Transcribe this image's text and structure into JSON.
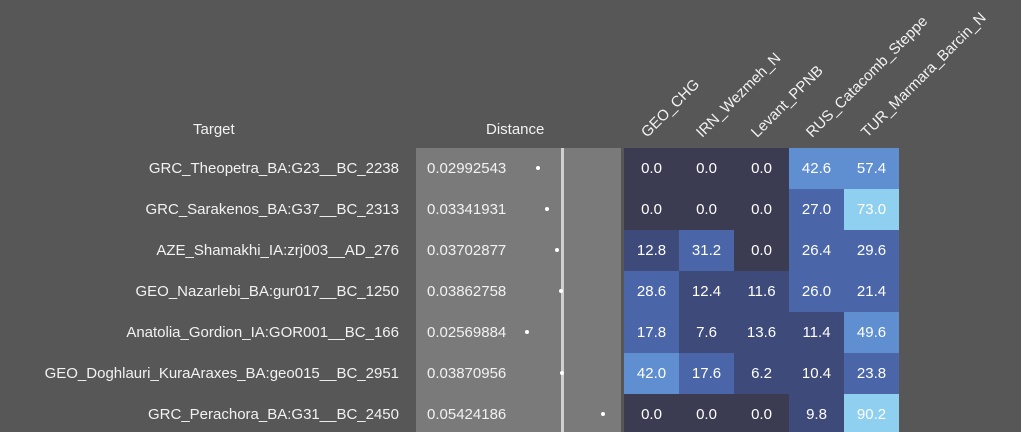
{
  "headers": {
    "target": "Target",
    "distance": "Distance"
  },
  "columns": [
    "GEO_CHG",
    "IRN_Wezmeh_N",
    "Levant_PPNB",
    "RUS_Catacomb_Steppe",
    "TUR_Marmara_Barcin_N"
  ],
  "colors": {
    "background": "#575757",
    "distance_panel": "#7a7a7a",
    "zero": "#3b3b52",
    "low": "#3d4a7a",
    "mid": "#4a66a8",
    "high": "#5f8fd0",
    "max": "#8fd0f0"
  },
  "rows": [
    {
      "target": "GRC_Theopetra_BA:G23__BC_2238",
      "distance": "0.02992543",
      "dist_num": 0.02992543,
      "values": [
        "0.0",
        "0.0",
        "0.0",
        "42.6",
        "57.4"
      ]
    },
    {
      "target": "GRC_Sarakenos_BA:G37__BC_2313",
      "distance": "0.03341931",
      "dist_num": 0.03341931,
      "values": [
        "0.0",
        "0.0",
        "0.0",
        "27.0",
        "73.0"
      ]
    },
    {
      "target": "AZE_Shamakhi_IA:zrj003__AD_276",
      "distance": "0.03702877",
      "dist_num": 0.03702877,
      "values": [
        "12.8",
        "31.2",
        "0.0",
        "26.4",
        "29.6"
      ]
    },
    {
      "target": "GEO_Nazarlebi_BA:gur017__BC_1250",
      "distance": "0.03862758",
      "dist_num": 0.03862758,
      "values": [
        "28.6",
        "12.4",
        "11.6",
        "26.0",
        "21.4"
      ]
    },
    {
      "target": "Anatolia_Gordion_IA:GOR001__BC_166",
      "distance": "0.02569884",
      "dist_num": 0.02569884,
      "values": [
        "17.8",
        "7.6",
        "13.6",
        "11.4",
        "49.6"
      ]
    },
    {
      "target": "GEO_Doghlauri_KuraAraxes_BA:geo015__BC_2951",
      "distance": "0.03870956",
      "dist_num": 0.03870956,
      "values": [
        "42.0",
        "17.6",
        "6.2",
        "10.4",
        "23.8"
      ]
    },
    {
      "target": "GRC_Perachora_BA:G31__BC_2450",
      "distance": "0.05424186",
      "dist_num": 0.05424186,
      "values": [
        "0.0",
        "0.0",
        "0.0",
        "9.8",
        "90.2"
      ]
    }
  ]
}
